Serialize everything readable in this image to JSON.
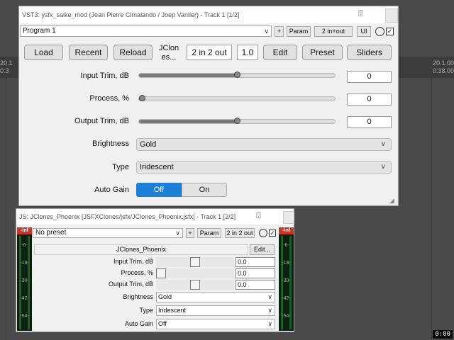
{
  "daw": {
    "ruler_left_top": "20.1",
    "ruler_left_bottom": "0:3",
    "ruler_right_top": "20.1.00",
    "ruler_right_bottom": "0:38.000",
    "clock": "0:00"
  },
  "vst": {
    "title": "VST3: ysfx_saike_mod (Jean Pierre Cimalando / Joep Vanlier) - Track 1 [1/2]",
    "preset": "Program 1",
    "plus": "+",
    "param": "Param",
    "io": "2 in+out",
    "ui": "UI",
    "buttons": {
      "load": "Load",
      "recent": "Recent",
      "reload": "Reload",
      "plugin_name": "JClon es...",
      "io_config": "2 in 2 out",
      "version": "1.0",
      "edit": "Edit",
      "preset": "Preset",
      "sliders": "Sliders"
    },
    "params": [
      {
        "label": "Input Trim, dB",
        "value": "0",
        "level": 0.5
      },
      {
        "label": "Process, %",
        "value": "0",
        "level": 0.0
      },
      {
        "label": "Output Trim, dB",
        "value": "0",
        "level": 0.5
      }
    ],
    "brightness": {
      "label": "Brightness",
      "value": "Gold"
    },
    "type": {
      "label": "Type",
      "value": "Iridescent"
    },
    "auto_gain": {
      "label": "Auto Gain",
      "off": "Off",
      "on": "On",
      "selected": "Off"
    },
    "accent_color": "#1e7fd6"
  },
  "js": {
    "title": "JS: JClones_Phoenix [JSFXClones/jsfx/JClones_Phoenix.jsfx] - Track 1 [2/2]",
    "preset": "No preset",
    "plus": "+",
    "param": "Param",
    "io": "2 in 2 out",
    "plugin_name": "JClones_Phoenix",
    "edit": "Edit...",
    "meter_labels": [
      "-inf",
      "-6-",
      "-18-",
      "-30-",
      "-42-",
      "-54-"
    ],
    "params": [
      {
        "label": "Input Trim, dB",
        "value": "0.0",
        "level": 0.5
      },
      {
        "label": "Process, %",
        "value": "0.0",
        "level": 0.0
      },
      {
        "label": "Output Trim, dB",
        "value": "0.0",
        "level": 0.5
      }
    ],
    "brightness": {
      "label": "Brightness",
      "value": "Gold"
    },
    "type": {
      "label": "Type",
      "value": "Iridescent"
    },
    "auto_gain": {
      "label": "Auto Gain",
      "value": "Off"
    }
  }
}
